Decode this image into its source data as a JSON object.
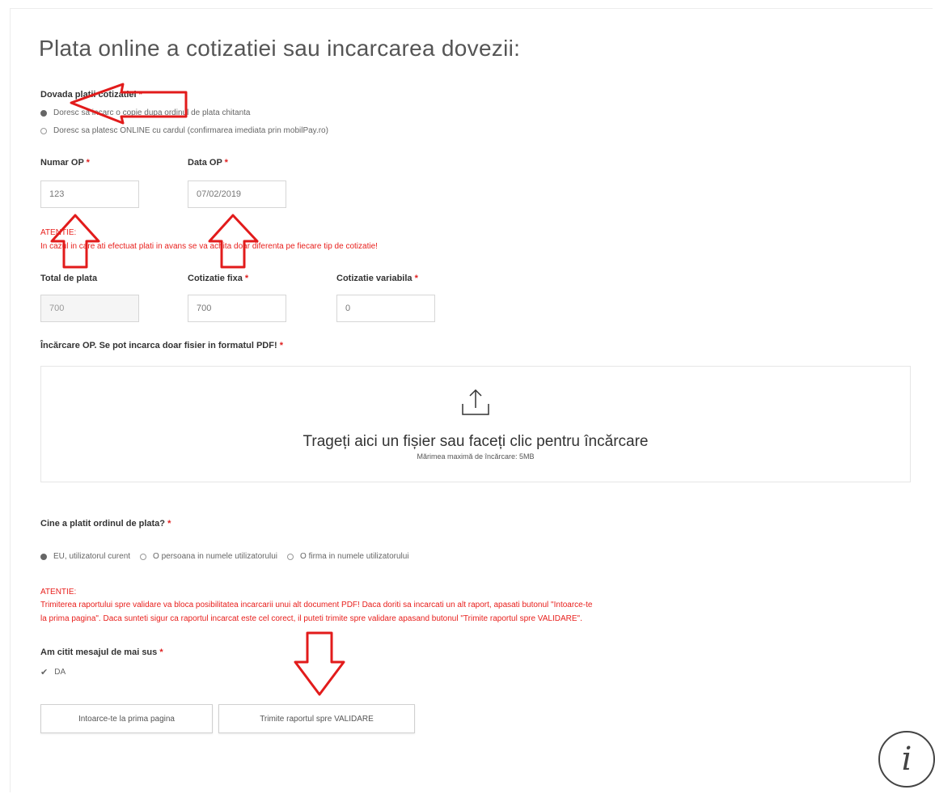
{
  "page": {
    "title": "Plata online a cotizatiei sau incarcarea dovezii:"
  },
  "payment_proof": {
    "label": "Dovada platii cotizatiei",
    "required_mark": "*",
    "options": [
      {
        "label": "Doresc sa incarc o copie dupa ordinul de plata chitanta",
        "selected": true
      },
      {
        "label": "Doresc sa platesc ONLINE cu cardul (confirmarea imediata prin mobilPay.ro)",
        "selected": false
      }
    ]
  },
  "op": {
    "number_label": "Numar OP",
    "number_value": "123",
    "date_label": "Data OP",
    "date_value": "07/02/2019",
    "required_mark": "*"
  },
  "warning1": {
    "title": "ATENTIE:",
    "text": "In cazul in care ati efectuat plati in avans se va achita doar diferenta pe fiecare tip de cotizatie!"
  },
  "amounts": {
    "total_label": "Total de plata",
    "total_value": "700",
    "fixed_label": "Cotizatie fixa",
    "fixed_value": "700",
    "variable_label": "Cotizatie variabila",
    "variable_value": "0",
    "required_mark": "*"
  },
  "upload": {
    "label": "Încărcare OP. Se pot incarca doar fisier in formatul PDF!",
    "required_mark": "*",
    "drop_text": "Trageți aici un fișier sau faceți clic pentru încărcare",
    "max_size_text": "Mărimea maximă de încărcare: 5MB",
    "icon": "upload-icon"
  },
  "payer": {
    "label": "Cine a platit ordinul de plata?",
    "required_mark": "*",
    "options": [
      {
        "label": "EU, utilizatorul curent",
        "selected": true
      },
      {
        "label": "O persoana in numele utilizatorului",
        "selected": false
      },
      {
        "label": "O firma in numele utilizatorului",
        "selected": false
      }
    ]
  },
  "warning2": {
    "title": "ATENTIE:",
    "line1": "Trimiterea raportului spre validare va bloca posibilitatea incarcarii unui alt document PDF! Daca doriti sa incarcati un alt raport, apasati butonul \"Intoarce-te",
    "line2": "la prima pagina\". Daca sunteti sigur ca raportul incarcat este cel corect, il puteti trimite spre validare apasand butonul \"Trimite raportul spre VALIDARE\"."
  },
  "confirm": {
    "label": "Am citit mesajul de mai sus",
    "required_mark": "*",
    "checkbox_label": "DA",
    "checked": true
  },
  "buttons": {
    "back": "Intoarce-te la prima pagina",
    "submit": "Trimite raportul spre VALIDARE"
  },
  "info_button": {
    "glyph": "i",
    "icon": "info-icon"
  },
  "colors": {
    "warning": "#e8201d",
    "annotation_arrow": "#e21b1b"
  }
}
